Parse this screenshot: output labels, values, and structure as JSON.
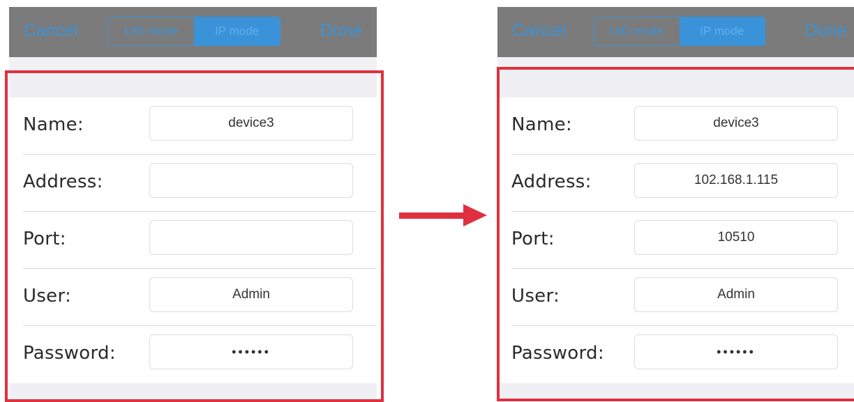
{
  "before": {
    "navbar": {
      "cancel_label": "Cancel",
      "done_label": "Done",
      "segments": [
        {
          "label": "UID mode",
          "selected": false
        },
        {
          "label": "IP mode",
          "selected": true
        }
      ]
    },
    "form": {
      "name": {
        "label": "Name:",
        "value": "device3"
      },
      "address": {
        "label": "Address:",
        "value": ""
      },
      "port": {
        "label": "Port:",
        "value": ""
      },
      "user": {
        "label": "User:",
        "value": "Admin"
      },
      "password": {
        "label": "Password:",
        "value": "••••••"
      }
    }
  },
  "after": {
    "navbar": {
      "cancel_label": "Cancel",
      "done_label": "Done",
      "segments": [
        {
          "label": "UID mode",
          "selected": false
        },
        {
          "label": "IP mode",
          "selected": true
        }
      ]
    },
    "form": {
      "name": {
        "label": "Name:",
        "value": "device3"
      },
      "address": {
        "label": "Address:",
        "value": "102.168.1.115"
      },
      "port": {
        "label": "Port:",
        "value": "10510"
      },
      "user": {
        "label": "User:",
        "value": "Admin"
      },
      "password": {
        "label": "Password:",
        "value": "••••••"
      }
    }
  },
  "colors": {
    "accent": "#3a93d8",
    "navbar": "#7b7b7b",
    "highlight": "#e0303f",
    "arrow": "#e0303f"
  },
  "icons": {
    "arrow": "right-arrow-icon"
  }
}
